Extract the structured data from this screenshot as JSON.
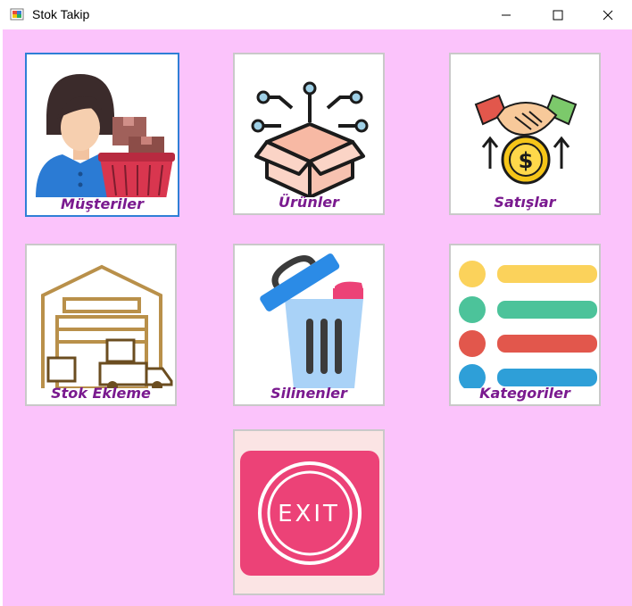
{
  "window": {
    "title": "Stok Takip",
    "icons": {
      "app": "app-icon",
      "minimize": "minimize-icon",
      "maximize": "maximize-icon",
      "close": "close-icon"
    }
  },
  "colors": {
    "background": "#fbc3fb",
    "caption": "#7a1a8f",
    "selected_border": "#2f7fd6",
    "exit_button": "#ec4277"
  },
  "tiles": [
    {
      "label": "Müşteriler",
      "icon": "customer-icon"
    },
    {
      "label": "Ürünler",
      "icon": "product-box-icon"
    },
    {
      "label": "Satışlar",
      "icon": "sales-handshake-icon"
    },
    {
      "label": "Stok Ekleme",
      "icon": "warehouse-icon"
    },
    {
      "label": "Silinenler",
      "icon": "trash-icon"
    },
    {
      "label": "Kategoriler",
      "icon": "category-list-icon"
    }
  ],
  "exit": {
    "label": "EXIT",
    "icon": "exit-icon"
  }
}
